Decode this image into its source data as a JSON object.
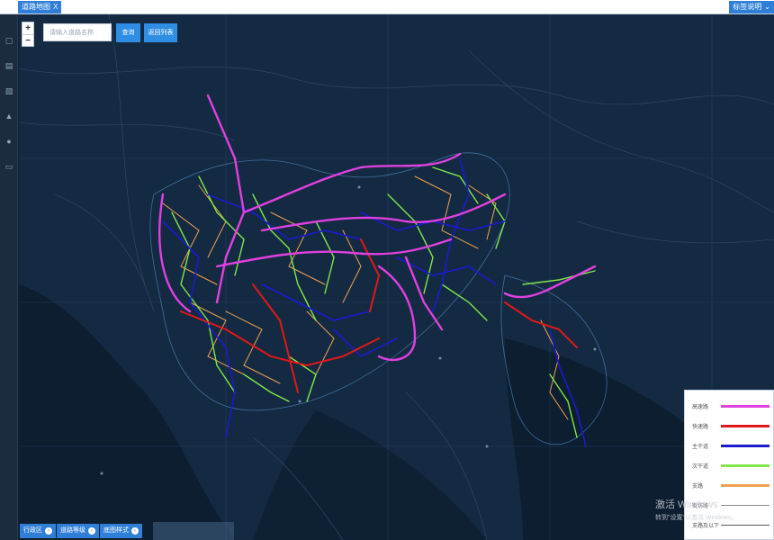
{
  "topbar": {
    "tab_label": "道路地图",
    "tab_close": "X",
    "legend_toggle_label": "标签说明",
    "legend_toggle_icon": "chevron-down-icon"
  },
  "rail": {
    "icons": [
      "file-icon",
      "chart-icon",
      "trash-icon",
      "road-icon",
      "pin-icon",
      "stats-icon"
    ]
  },
  "map_controls": {
    "zoom_in": "+",
    "zoom_out": "−"
  },
  "search": {
    "placeholder": "请输入道路名称",
    "query_label": "查询",
    "back_label": "返回列表"
  },
  "bottom_buttons": [
    {
      "label": "行政区",
      "icon": "chevron-icon"
    },
    {
      "label": "道路等级",
      "icon": "chevron-icon"
    },
    {
      "label": "底图样式",
      "icon": "chevron-icon"
    }
  ],
  "legend": {
    "items": [
      {
        "label": "高速路",
        "color": "#e040e0"
      },
      {
        "label": "快速路",
        "color": "#e01818"
      },
      {
        "label": "主干道",
        "color": "#1a1ad0"
      },
      {
        "label": "次干道",
        "color": "#7ee84a"
      },
      {
        "label": "支路",
        "color": "#f0a050"
      },
      {
        "label": "街坊路",
        "color": "#888888"
      },
      {
        "label": "支路及以下",
        "color": "#555555"
      }
    ]
  },
  "watermark": {
    "line1": "激活 Windows",
    "line2": "转到\"设置\"以激活 Windows。"
  }
}
